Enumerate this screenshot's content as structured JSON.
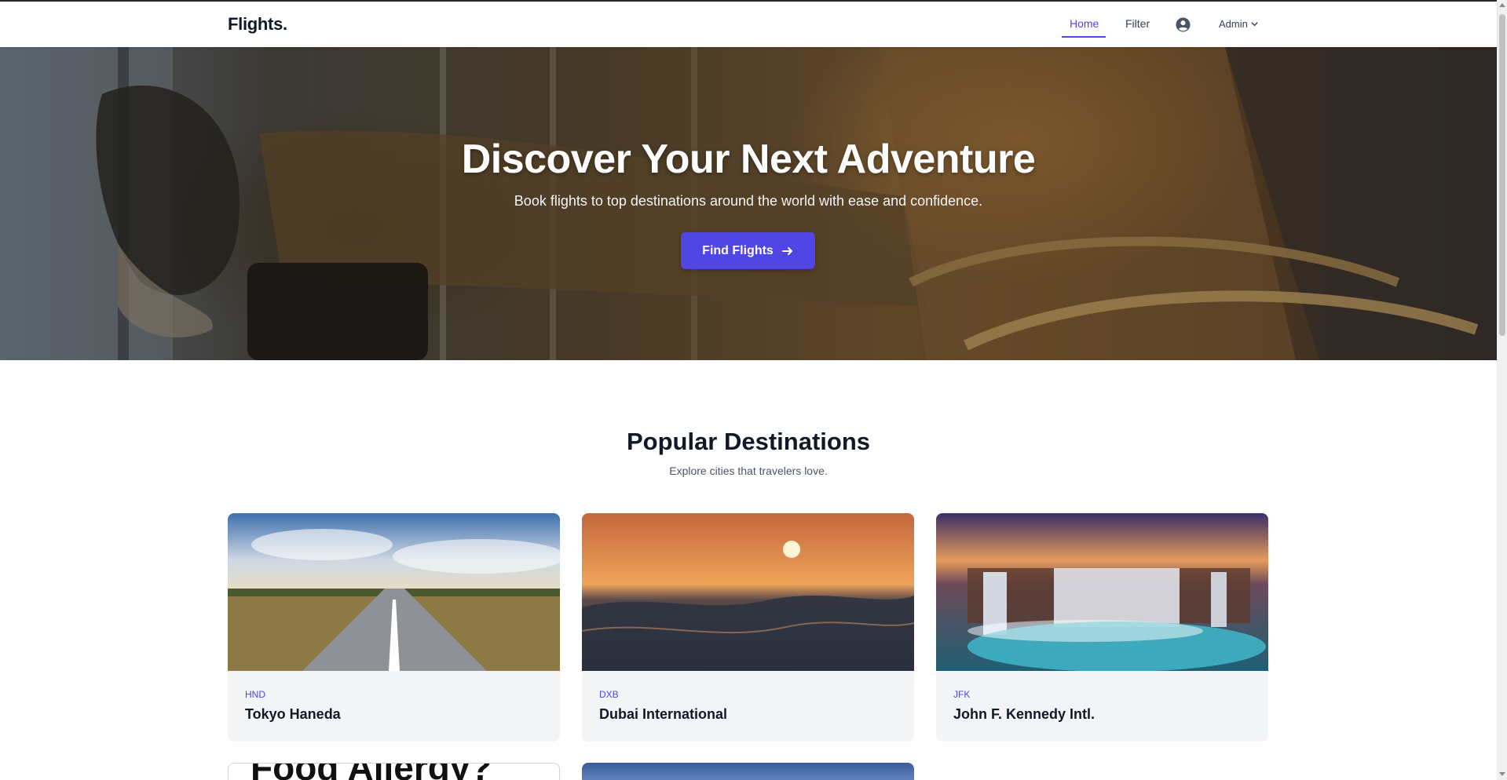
{
  "nav": {
    "brand": "Flights.",
    "links": [
      {
        "label": "Home",
        "active": true
      },
      {
        "label": "Filter",
        "active": false
      }
    ],
    "user_icon": "user-circle-icon",
    "admin_label": "Admin",
    "admin_icon": "chevron-down-icon",
    "accent_color": "#4f46e5"
  },
  "hero": {
    "title": "Discover Your Next Adventure",
    "subtitle": "Book flights to top destinations around the world with ease and confidence.",
    "cta_label": "Find Flights",
    "cta_icon": "arrow-right-icon"
  },
  "destinations": {
    "title": "Popular Destinations",
    "subtitle": "Explore cities that travelers love.",
    "cards": [
      {
        "code": "HND",
        "name": "Tokyo Haneda"
      },
      {
        "code": "DXB",
        "name": "Dubai International"
      },
      {
        "code": "JFK",
        "name": "John F. Kennedy Intl."
      }
    ],
    "partial_card_text": "Food Allergy?"
  }
}
